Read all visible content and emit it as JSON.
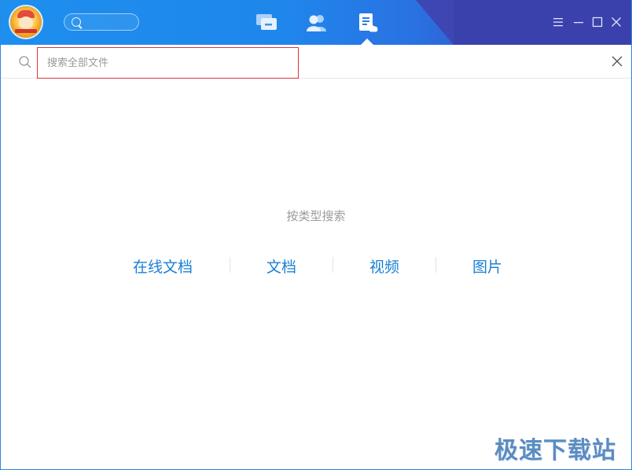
{
  "titlebar": {
    "nav": [
      {
        "name": "chat-icon"
      },
      {
        "name": "contacts-icon"
      },
      {
        "name": "files-icon",
        "active": true
      }
    ],
    "window_controls": [
      "menu-icon",
      "minimize-icon",
      "maximize-icon",
      "close-icon"
    ]
  },
  "search": {
    "placeholder": "搜索全部文件",
    "value": ""
  },
  "content": {
    "title": "按类型搜索",
    "types": [
      "在线文档",
      "文档",
      "视频",
      "图片"
    ]
  },
  "watermark": "极速下载站",
  "colors": {
    "titlebar_start": "#1d8fee",
    "titlebar_end": "#3a3fae",
    "link": "#1a7fd4",
    "input_border": "#d9363e"
  }
}
